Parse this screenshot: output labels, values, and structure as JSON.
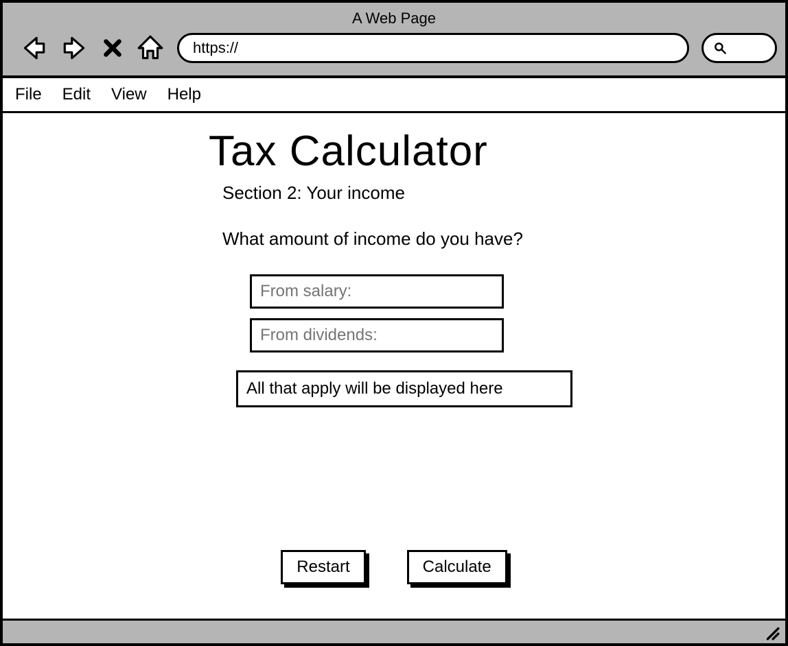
{
  "browser": {
    "title": "A Web Page",
    "url": "https://",
    "icons": {
      "back": "back-arrow-icon",
      "forward": "forward-arrow-icon",
      "stop": "stop-x-icon",
      "home": "home-icon",
      "search": "search-icon"
    }
  },
  "menubar": {
    "items": [
      "File",
      "Edit",
      "View",
      "Help"
    ]
  },
  "main": {
    "title": "Tax Calculator",
    "section_title": "Section 2: Your income",
    "question": "What amount of income do you have?",
    "fields": {
      "salary_label": "From salary:",
      "dividends_label": "From dividends:"
    },
    "result_placeholder": "All that apply will be displayed here",
    "buttons": {
      "restart": "Restart",
      "calculate": "Calculate"
    }
  }
}
